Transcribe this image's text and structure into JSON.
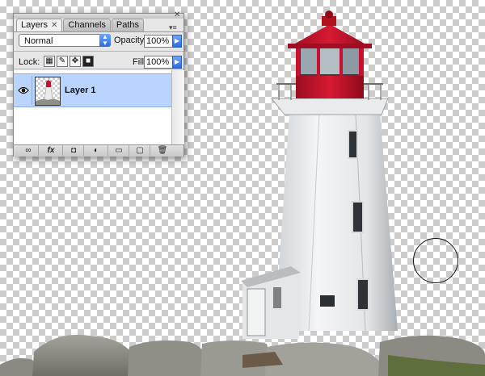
{
  "panel": {
    "tabs": [
      {
        "label": "Layers",
        "close": "✕"
      },
      {
        "label": "Channels"
      },
      {
        "label": "Paths"
      }
    ],
    "close_glyph": "✕",
    "menu_glyph": "▾≡",
    "blend_mode": "Normal",
    "opacity_label": "Opacity:",
    "opacity_value": "100%",
    "lock_label": "Lock:",
    "fill_label": "Fill:",
    "fill_value": "100%",
    "layers": [
      {
        "name": "Layer 1",
        "visible": true,
        "selected": true
      }
    ],
    "bottom_buttons": [
      {
        "icon": "link-layers-icon",
        "glyph": "∞"
      },
      {
        "icon": "layer-style-icon",
        "glyph": "fx"
      },
      {
        "icon": "layer-mask-icon",
        "glyph": "◘"
      },
      {
        "icon": "adjustment-layer-icon",
        "glyph": "◐"
      },
      {
        "icon": "new-group-icon",
        "glyph": "▭"
      },
      {
        "icon": "new-layer-icon",
        "glyph": "▢"
      },
      {
        "icon": "trash-icon",
        "glyph": "🗑"
      }
    ]
  },
  "colors": {
    "lighthouse_red": "#c8102e",
    "selection_blue": "#b8d4ff",
    "checker": "#cccccc"
  },
  "canvas": {
    "subject": "lighthouse on rocks, background removed (transparency checkerboard)"
  }
}
